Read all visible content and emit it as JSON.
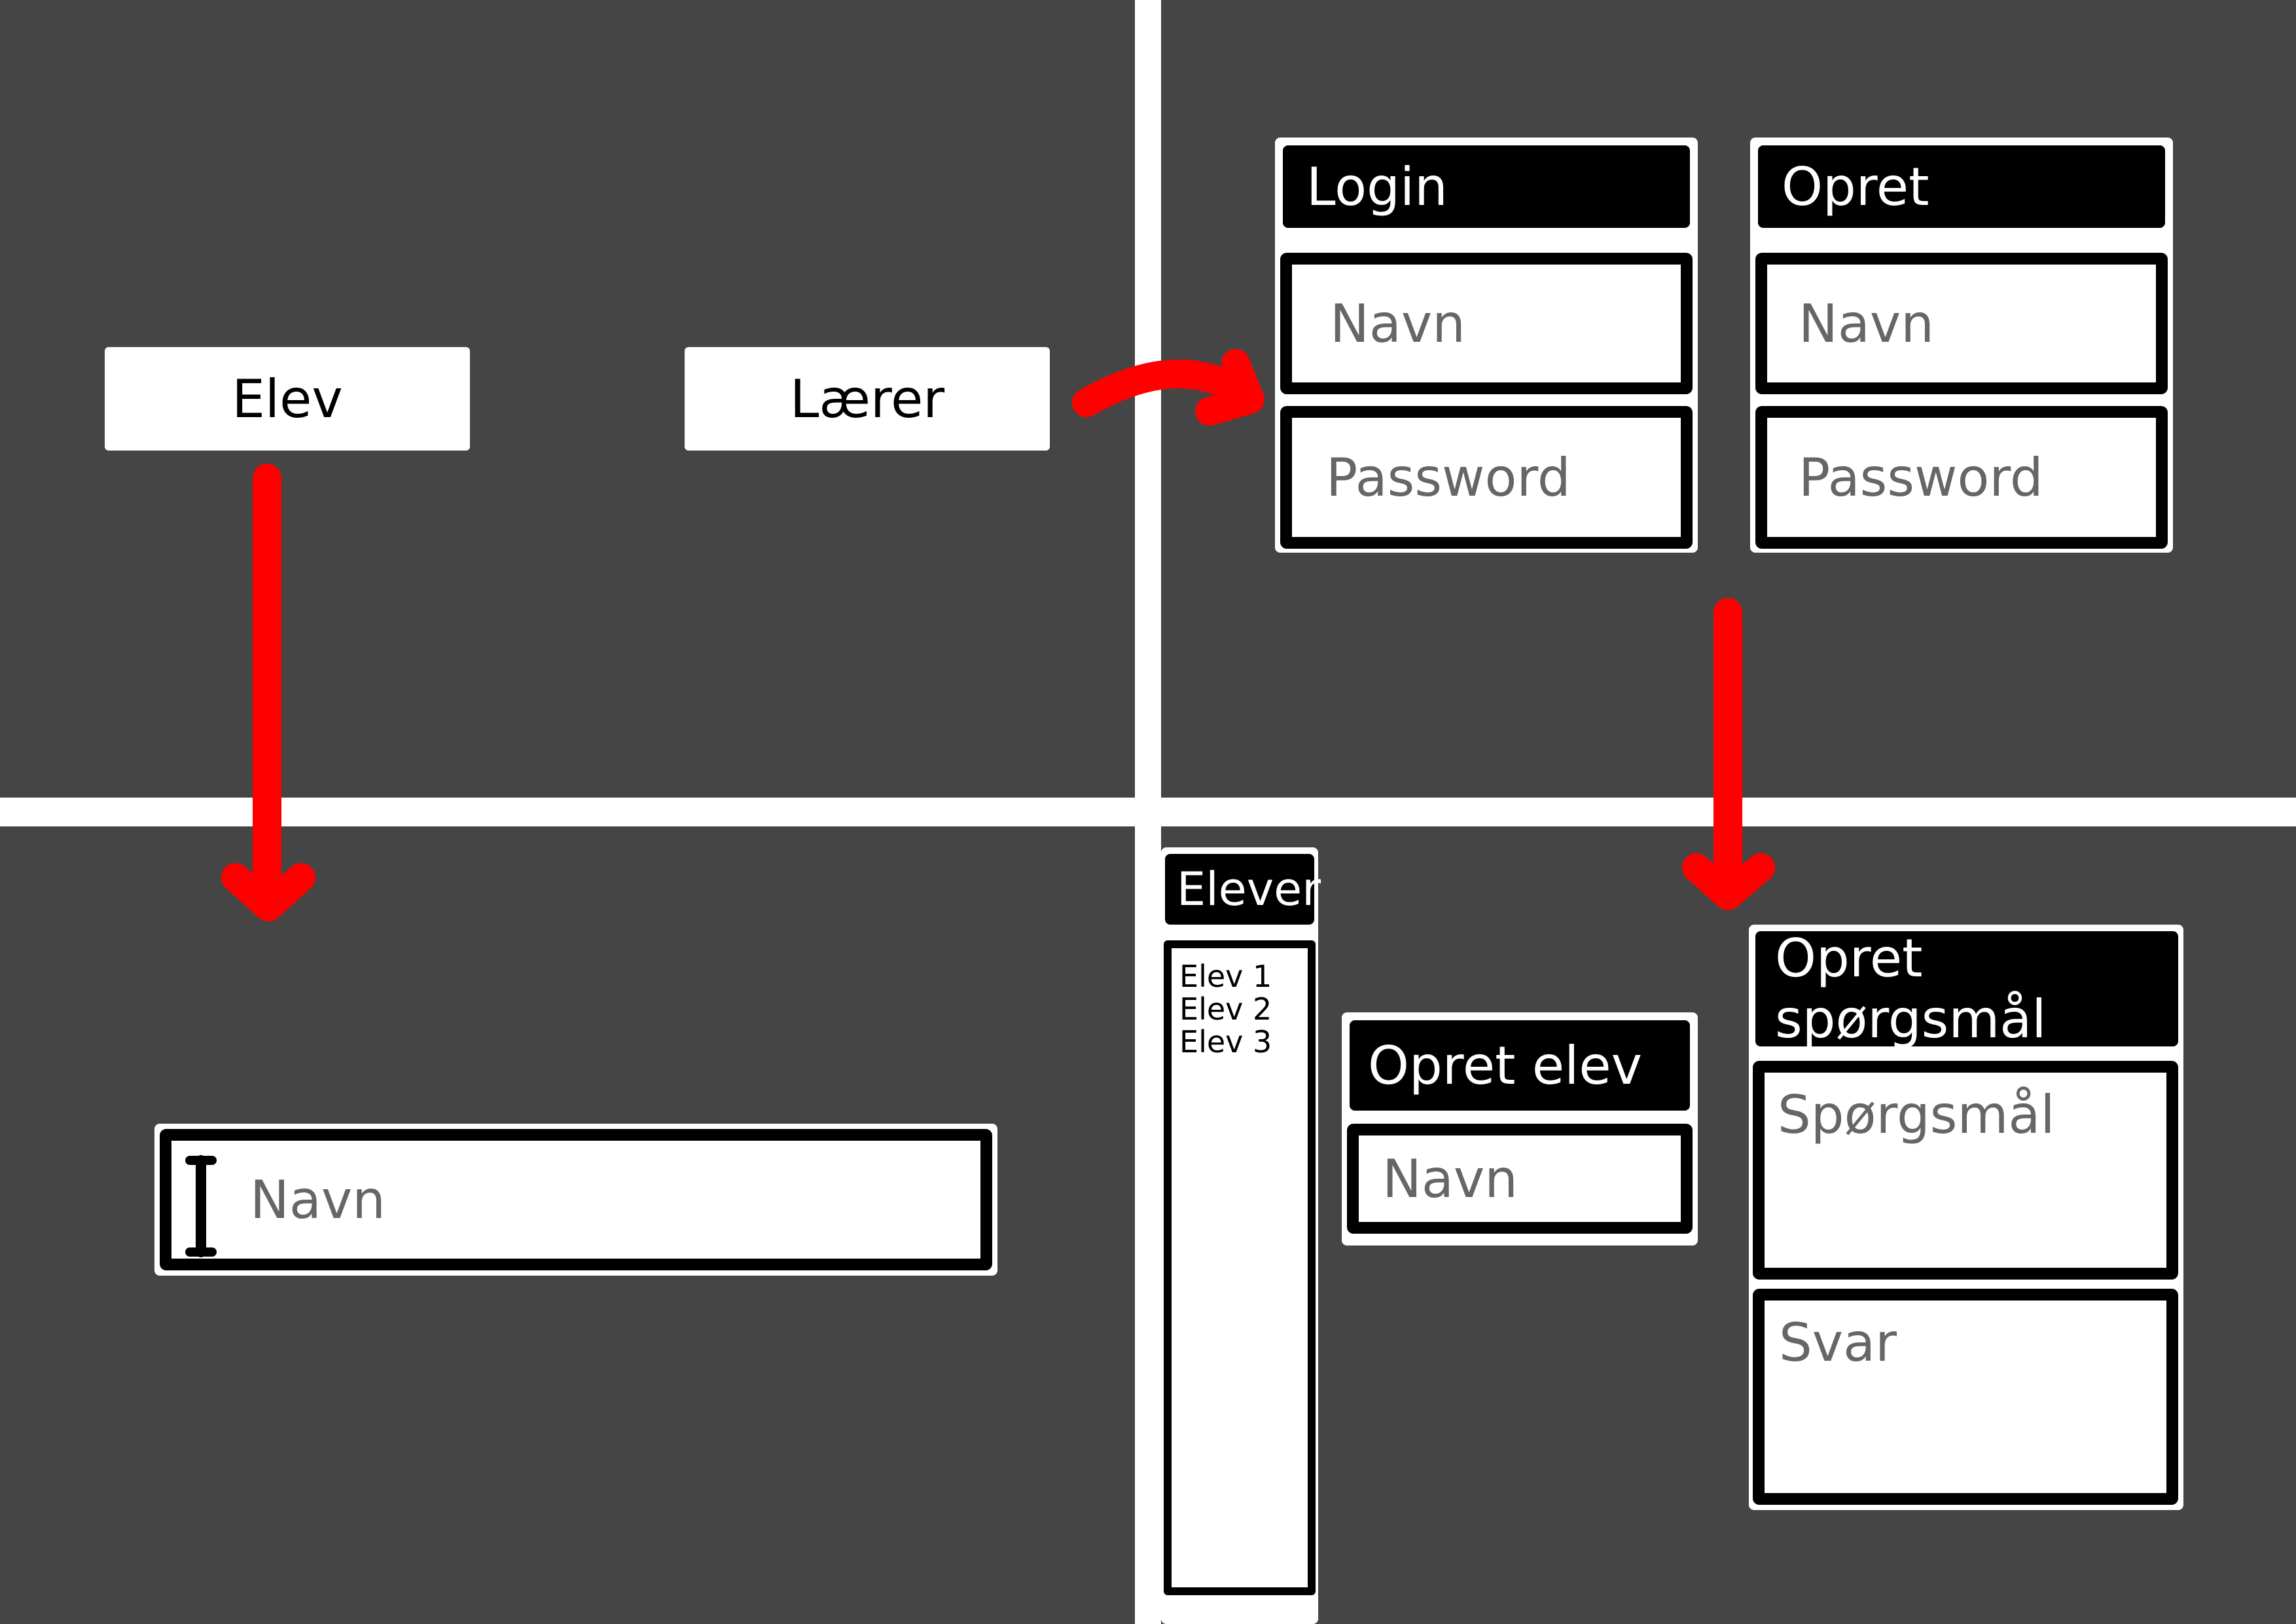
{
  "start": {
    "elev_button": "Elev",
    "laerer_button": "Lærer"
  },
  "elev_screen": {
    "navn_placeholder": "Navn"
  },
  "teacher_auth": {
    "login": {
      "title": "Login",
      "navn_placeholder": "Navn",
      "password_placeholder": "Password"
    },
    "opret": {
      "title": "Opret",
      "navn_placeholder": "Navn",
      "password_placeholder": "Password"
    }
  },
  "teacher_dashboard": {
    "elever": {
      "title": "Elever",
      "items": [
        "Elev 1",
        "Elev 2",
        "Elev 3"
      ]
    },
    "opret_elev": {
      "title": "Opret elev",
      "navn_placeholder": "Navn"
    },
    "opret_spoergsmaal": {
      "title": "Opret spørgsmål",
      "spoergsmaal_placeholder": "Spørgsmål",
      "svar_placeholder": "Svar"
    }
  },
  "colors": {
    "panel_background": "#454545",
    "divider": "#ffffff",
    "arrow": "#ff0000",
    "header": "#000000",
    "placeholder_text": "#666666"
  }
}
